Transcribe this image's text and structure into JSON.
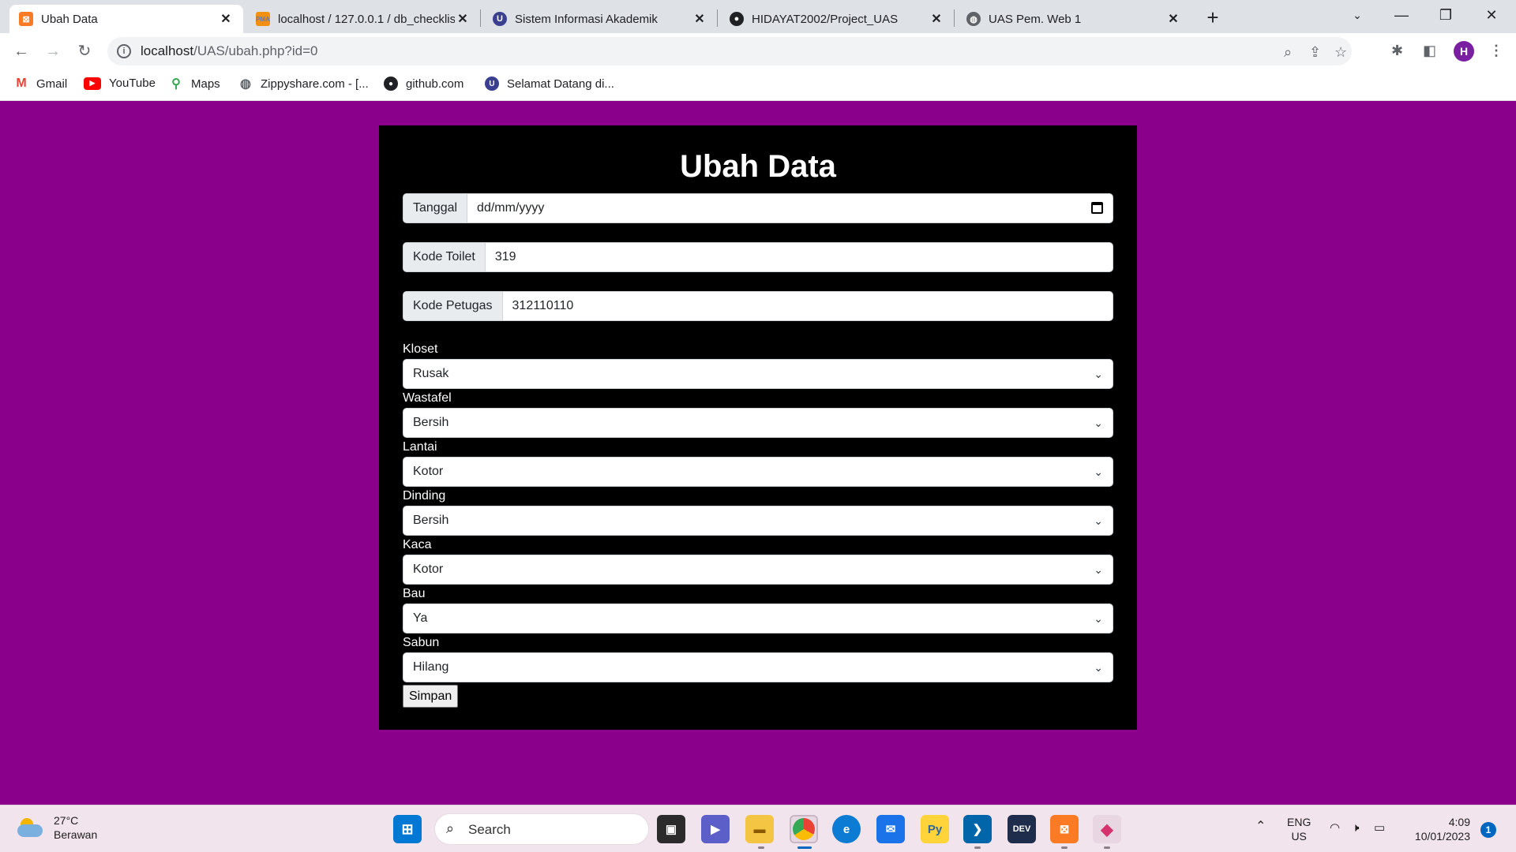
{
  "browser": {
    "tabs": [
      {
        "title": "Ubah Data",
        "favicon": "xampp-icon",
        "active": true
      },
      {
        "title": "localhost / 127.0.0.1 / db_checklis",
        "favicon": "phpmyadmin-icon",
        "active": false
      },
      {
        "title": "Sistem Informasi Akademik",
        "favicon": "university-icon",
        "active": false
      },
      {
        "title": "HIDAYAT2002/Project_UAS",
        "favicon": "github-icon",
        "active": false
      },
      {
        "title": "UAS Pem. Web 1",
        "favicon": "globe-icon",
        "active": false
      }
    ],
    "url_host": "localhost",
    "url_path": "/UAS/ubah.php?id=0",
    "profile_initial": "H",
    "bookmarks": [
      {
        "label": "Gmail",
        "icon": "gmail-icon"
      },
      {
        "label": "YouTube",
        "icon": "youtube-icon"
      },
      {
        "label": "Maps",
        "icon": "maps-icon"
      },
      {
        "label": "Zippyshare.com - [...",
        "icon": "globe-icon"
      },
      {
        "label": "github.com",
        "icon": "github-icon"
      },
      {
        "label": "Selamat Datang di...",
        "icon": "university-icon"
      }
    ]
  },
  "form": {
    "title": "Ubah Data",
    "tanggal": {
      "label": "Tanggal",
      "placeholder": "dd/mm/yyyy"
    },
    "kode_toilet": {
      "label": "Kode Toilet",
      "value": "319"
    },
    "kode_petugas": {
      "label": "Kode Petugas",
      "value": "312110110"
    },
    "selects": [
      {
        "label": "Kloset",
        "value": "Rusak"
      },
      {
        "label": "Wastafel",
        "value": "Bersih"
      },
      {
        "label": "Lantai",
        "value": "Kotor"
      },
      {
        "label": "Dinding",
        "value": "Bersih"
      },
      {
        "label": "Kaca",
        "value": "Kotor"
      },
      {
        "label": "Bau",
        "value": "Ya"
      },
      {
        "label": "Sabun",
        "value": "Hilang"
      }
    ],
    "submit_label": "Simpan"
  },
  "taskbar": {
    "weather_temp": "27°C",
    "weather_desc": "Berawan",
    "search_label": "Search",
    "lang_top": "ENG",
    "lang_bottom": "US",
    "time": "4:09",
    "date": "10/01/2023",
    "notifications": "1"
  },
  "colors": {
    "page_background": "#8b008b",
    "card_background": "#000000"
  }
}
